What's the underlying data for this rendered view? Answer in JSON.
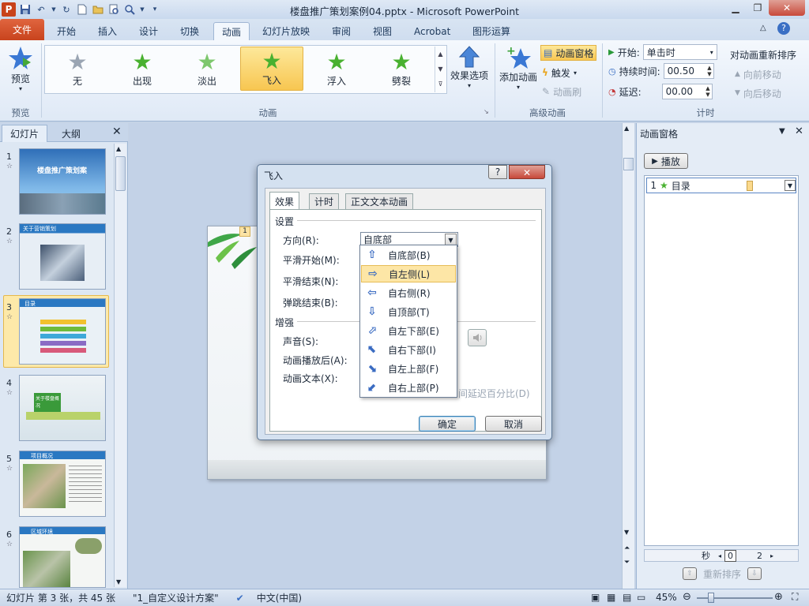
{
  "window": {
    "title": "楼盘推广策划案例04.pptx - Microsoft PowerPoint",
    "app_icon_letter": "P"
  },
  "tabs": [
    "文件",
    "开始",
    "插入",
    "设计",
    "切换",
    "动画",
    "幻灯片放映",
    "审阅",
    "视图",
    "Acrobat",
    "图形运算"
  ],
  "ribbon": {
    "preview_label": "预览",
    "preview_group": "预览",
    "gallery": [
      "无",
      "出现",
      "淡出",
      "飞入",
      "浮入",
      "劈裂"
    ],
    "effect_options": "效果选项",
    "animation_group": "动画",
    "add_animation": "添加动画",
    "anim_pane": "动画窗格",
    "trigger": "触发",
    "anim_painter": "动画刷",
    "advanced_group": "高级动画",
    "start_label": "开始:",
    "start_value": "单击时",
    "duration_label": "持续时间:",
    "duration_value": "00.50",
    "delay_label": "延迟:",
    "delay_value": "00.00",
    "reorder_title": "对动画重新排序",
    "move_earlier": "向前移动",
    "move_later": "向后移动",
    "timing_group": "计时"
  },
  "slides_pane": {
    "tabs": [
      "幻灯片",
      "大纲"
    ],
    "thumbs": [
      {
        "num": "1",
        "title": "楼盘推广策划案"
      },
      {
        "num": "2",
        "title": "关于营销策划"
      },
      {
        "num": "3",
        "title": "目录"
      },
      {
        "num": "4",
        "title": "关于楼盘概况"
      },
      {
        "num": "5",
        "title": "项目概况"
      },
      {
        "num": "6",
        "title": "区域环境"
      }
    ]
  },
  "slide": {
    "anim_badge": "1"
  },
  "dialog": {
    "title": "飞入",
    "help": "?",
    "tabs": [
      "效果",
      "计时",
      "正文文本动画"
    ],
    "settings_section": "设置",
    "direction_label": "方向(R):",
    "direction_value": "自底部",
    "smooth_start": "平滑开始(M):",
    "smooth_end": "平滑结束(N):",
    "bounce_end": "弹跳结束(B):",
    "enhance_section": "增强",
    "sound_label": "声音(S):",
    "after_anim_label": "动画播放后(A):",
    "anim_text_label": "动画文本(X):",
    "delay_pct_text": "间延迟百分比(D)",
    "ok": "确定",
    "cancel": "取消"
  },
  "direction_options": [
    {
      "arrow": "⇧",
      "label": "自底部(B)"
    },
    {
      "arrow": "⇨",
      "label": "自左侧(L)"
    },
    {
      "arrow": "⇦",
      "label": "自右侧(R)"
    },
    {
      "arrow": "⇩",
      "label": "自顶部(T)"
    },
    {
      "arrow": "⬀",
      "label": "自左下部(E)"
    },
    {
      "arrow": "⬉",
      "label": "自右下部(I)"
    },
    {
      "arrow": "⬊",
      "label": "自左上部(F)"
    },
    {
      "arrow": "⬋",
      "label": "自右上部(P)"
    }
  ],
  "anim_pane": {
    "title": "动画窗格",
    "play": "播放",
    "item_num": "1",
    "item_label": "目录",
    "seconds": "秒",
    "ruler_0": "0",
    "ruler_2": "2",
    "reorder": "重新排序"
  },
  "status": {
    "slide_info": "幻灯片 第 3 张，共 45 张",
    "theme": "\"1_自定义设计方案\"",
    "language": "中文(中国)",
    "zoom": "45%"
  }
}
